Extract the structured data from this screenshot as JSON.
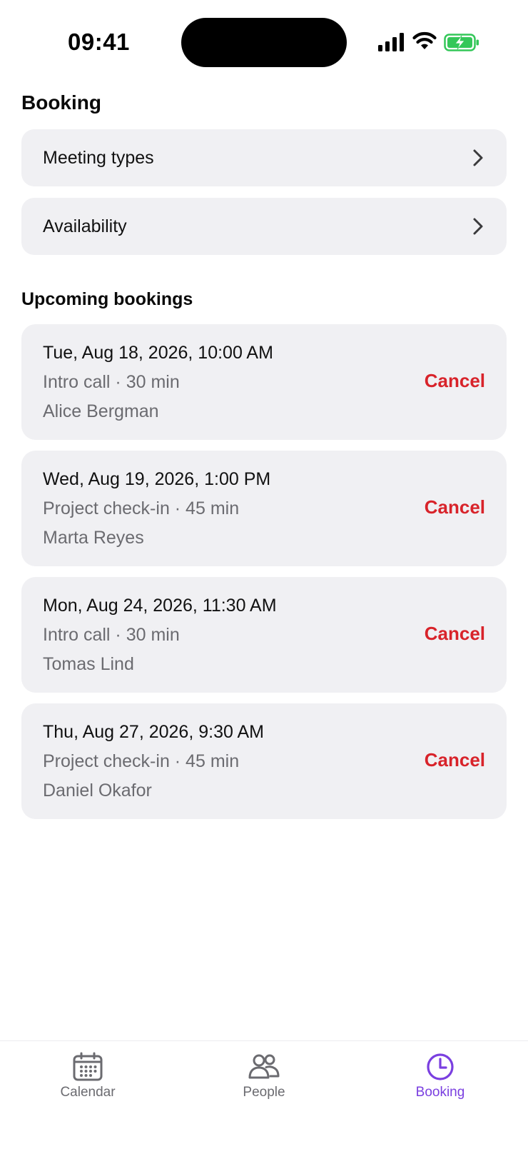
{
  "status_bar": {
    "time": "09:41",
    "icons": [
      "signal-icon",
      "wifi-icon",
      "battery-charging-icon"
    ]
  },
  "booking": {
    "title": "Booking",
    "menu": [
      {
        "label": "Meeting types",
        "icon": "chevron-right-icon"
      },
      {
        "label": "Availability",
        "icon": "chevron-right-icon"
      }
    ]
  },
  "upcoming": {
    "title": "Upcoming bookings",
    "items": [
      {
        "datetime": "Tue, Aug 18, 2026, 10:00 AM",
        "meta": "Intro call · 30 min",
        "person": "Alice Bergman",
        "action": "Cancel"
      },
      {
        "datetime": "Wed, Aug 19, 2026, 1:00 PM",
        "meta": "Project check-in · 45 min",
        "person": "Marta Reyes",
        "action": "Cancel"
      },
      {
        "datetime": "Mon, Aug 24, 2026, 11:30 AM",
        "meta": "Intro call · 30 min",
        "person": "Tomas Lind",
        "action": "Cancel"
      },
      {
        "datetime": "Thu, Aug 27, 2026, 9:30 AM",
        "meta": "Project check-in · 45 min",
        "person": "Daniel Okafor",
        "action": "Cancel"
      }
    ]
  },
  "tabs": [
    {
      "label": "Calendar",
      "icon": "calendar-icon",
      "active": false
    },
    {
      "label": "People",
      "icon": "people-icon",
      "active": false
    },
    {
      "label": "Booking",
      "icon": "clock-icon",
      "active": true
    }
  ],
  "colors": {
    "accent": "#7a3fe0",
    "danger": "#d8232a",
    "card_bg": "#f0f0f3",
    "secondary_text": "#6b6b70",
    "battery": "#34c759"
  }
}
